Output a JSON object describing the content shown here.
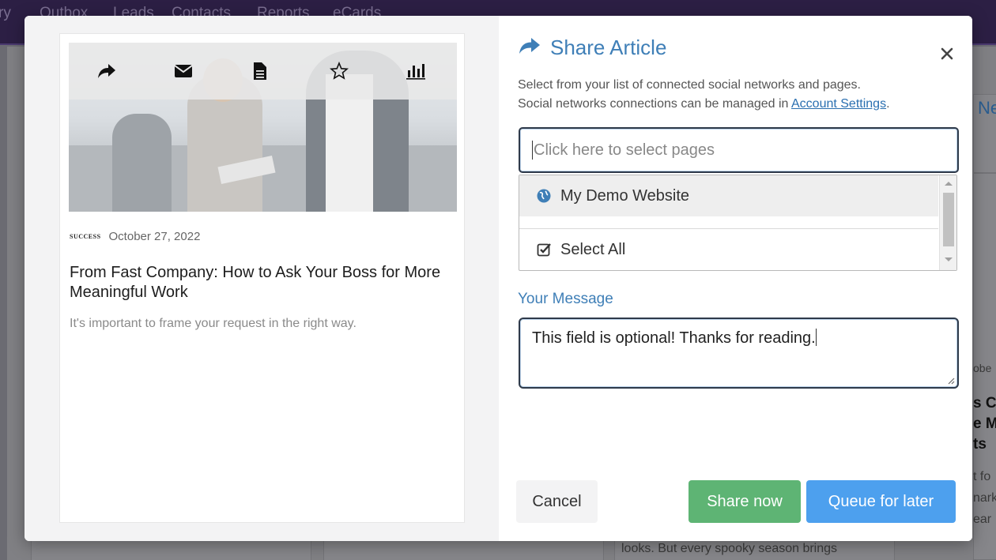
{
  "background": {
    "nav_items": [
      "ry",
      "Outbox",
      "Leads",
      "Contacts",
      "Reports",
      "eCards"
    ],
    "card_fragment_lines": [
      "Ne",
      "obe",
      "s C",
      "e M",
      "ts",
      "t fo",
      "nark",
      "ear"
    ],
    "footer_text": "looks. But every spooky season brings"
  },
  "article": {
    "actions": [
      {
        "name": "share",
        "icon": "share-arrow-icon"
      },
      {
        "name": "email",
        "icon": "envelope-icon"
      },
      {
        "name": "document",
        "icon": "document-icon"
      },
      {
        "name": "favorite",
        "icon": "star-icon"
      },
      {
        "name": "stats",
        "icon": "bar-chart-icon"
      }
    ],
    "source": "SUCCESS",
    "date": "October 27, 2022",
    "title": "From Fast Company: How to Ask Your Boss for More Meaningful Work",
    "summary": "It's important to frame your request in the right way."
  },
  "share": {
    "title": "Share Article",
    "instructions_line1": "Select from your list of connected social networks and pages.",
    "instructions_line2": "Social networks connections can be managed in",
    "settings_link": "Account Settings",
    "instructions_end": ".",
    "select_placeholder": "Click here to select pages",
    "options": [
      {
        "label": "My Demo Website",
        "icon": "globe-icon"
      },
      {
        "label": "Select All",
        "icon": "checkbox-icon"
      }
    ],
    "message_label": "Your Message",
    "message_value": "This field is optional! Thanks for reading.",
    "cancel_label": "Cancel",
    "share_now_label": "Share now",
    "queue_label": "Queue for later"
  },
  "colors": {
    "accent": "#3f7fb7",
    "share_now": "#5eb474",
    "queue": "#4da0ee",
    "nav_bg": "#2c1f44"
  }
}
